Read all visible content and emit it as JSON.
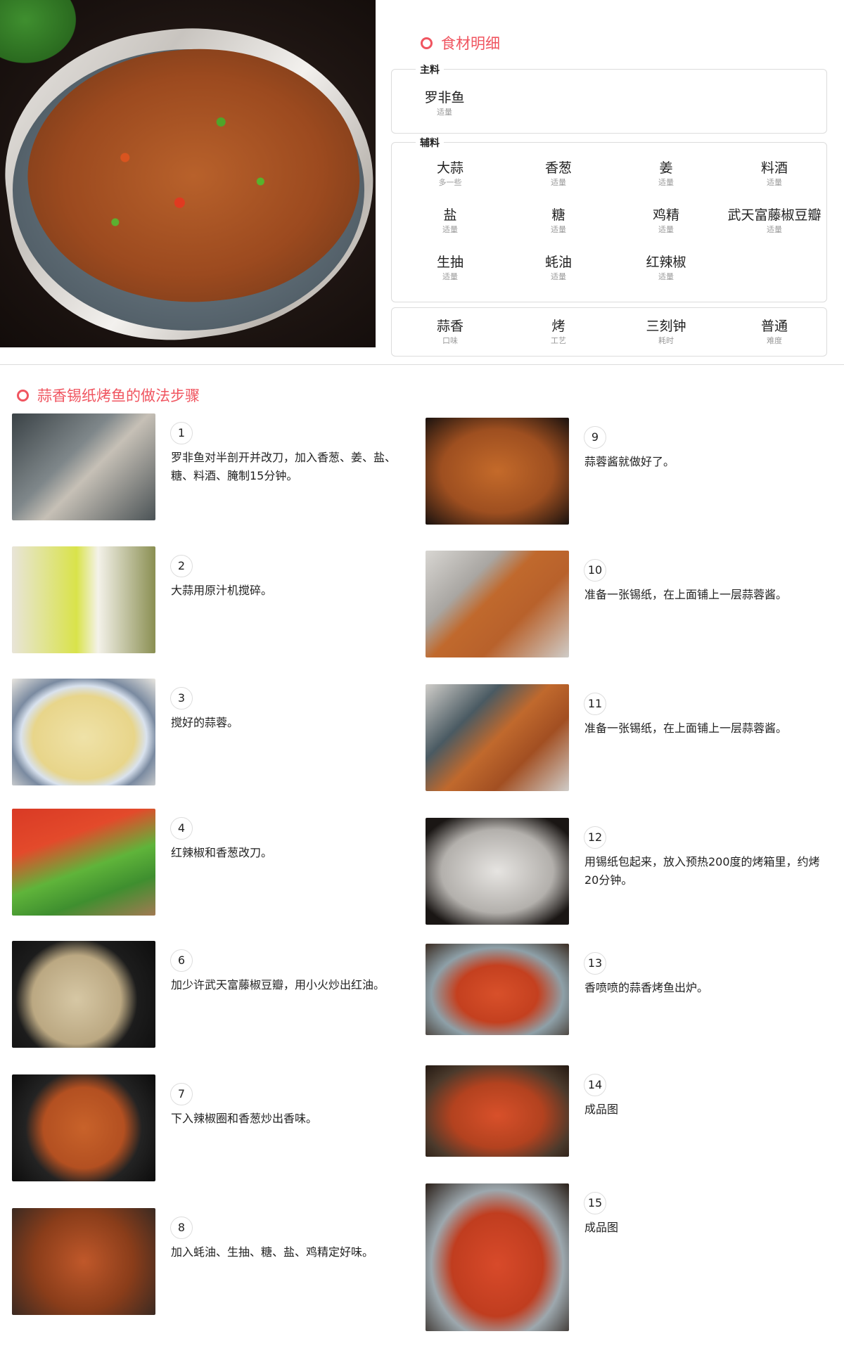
{
  "ingredients_title": "食材明细",
  "main_label": "主料",
  "main": [
    {
      "name": "罗非鱼",
      "qty": "适量"
    }
  ],
  "aux_label": "辅料",
  "aux": [
    {
      "name": "大蒜",
      "qty": "多一些"
    },
    {
      "name": "香葱",
      "qty": "适量"
    },
    {
      "name": "姜",
      "qty": "适量"
    },
    {
      "name": "料酒",
      "qty": "适量"
    },
    {
      "name": "盐",
      "qty": "适量"
    },
    {
      "name": "糖",
      "qty": "适量"
    },
    {
      "name": "鸡精",
      "qty": "适量"
    },
    {
      "name": "武天富藤椒豆瓣",
      "qty": "适量"
    },
    {
      "name": "生抽",
      "qty": "适量"
    },
    {
      "name": "蚝油",
      "qty": "适量"
    },
    {
      "name": "红辣椒",
      "qty": "适量"
    }
  ],
  "props": [
    {
      "name": "蒜香",
      "qty": "口味"
    },
    {
      "name": "烤",
      "qty": "工艺"
    },
    {
      "name": "三刻钟",
      "qty": "耗时"
    },
    {
      "name": "普通",
      "qty": "难度"
    }
  ],
  "steps_title": "蒜香锡纸烤鱼的做法步骤",
  "steps": [
    {
      "num": "1",
      "text": "罗非鱼对半剖开并改刀，加入香葱、姜、盐、糖、料酒、腌制15分钟。"
    },
    {
      "num": "2",
      "text": "大蒜用原汁机搅碎。"
    },
    {
      "num": "3",
      "text": "搅好的蒜蓉。"
    },
    {
      "num": "4",
      "text": "红辣椒和香葱改刀。"
    },
    {
      "num": "6",
      "text": "加少许武天富藤椒豆瓣，用小火炒出红油。"
    },
    {
      "num": "7",
      "text": "下入辣椒圈和香葱炒出香味。"
    },
    {
      "num": "8",
      "text": "加入蚝油、生抽、糖、盐、鸡精定好味。"
    },
    {
      "num": "9",
      "text": "蒜蓉酱就做好了。"
    },
    {
      "num": "10",
      "text": "准备一张锡纸，在上面铺上一层蒜蓉酱。"
    },
    {
      "num": "11",
      "text": "准备一张锡纸，在上面铺上一层蒜蓉酱。"
    },
    {
      "num": "12",
      "text": "用锡纸包起来，放入预热200度的烤箱里，约烤20分钟。"
    },
    {
      "num": "13",
      "text": "香喷喷的蒜香烤鱼出炉。"
    },
    {
      "num": "14",
      "text": "成品图"
    },
    {
      "num": "15",
      "text": "成品图"
    }
  ],
  "colors": {
    "accent": "#f05560",
    "border": "#dcdcdc",
    "muted": "#999999"
  }
}
